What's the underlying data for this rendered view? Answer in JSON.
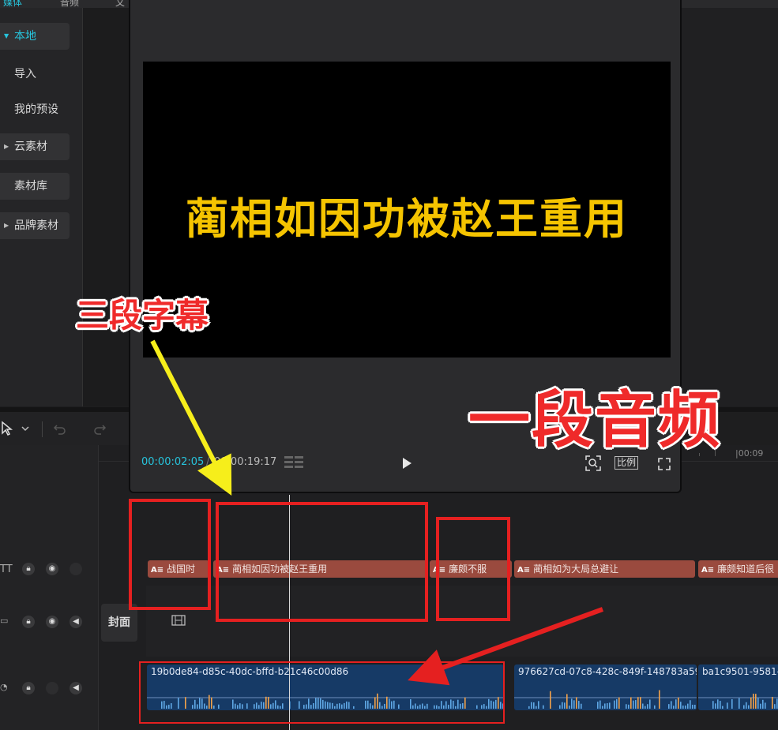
{
  "menu": {
    "items": [
      "媒体",
      "音频",
      "文"
    ]
  },
  "sidebar": {
    "items": [
      {
        "label": "本地",
        "state": "expanded"
      },
      {
        "label": "导入"
      },
      {
        "label": "我的预设"
      },
      {
        "label": "云素材",
        "state": "collapsed"
      },
      {
        "label": "素材库"
      },
      {
        "label": "品牌素材",
        "state": "collapsed"
      }
    ]
  },
  "player": {
    "subtitle": "蔺相如因功被赵王重用",
    "current_time": "00:00:02:05",
    "total_time": "00:00:19:17",
    "ratio_label": "比例"
  },
  "ruler": {
    "label": "|00:09"
  },
  "timeline": {
    "cover_label": "封面",
    "text_clips": [
      "战国时",
      "蔺相如因功被赵王重用",
      "廉颇不服",
      "蔺相如为大局总避让",
      "廉颇知道后很"
    ],
    "audio_clips": [
      "19b0de84-d85c-40dc-bffd-b21c46c00d86",
      "976627cd-07c8-428c-849f-148783a59",
      "ba1c9501-9581-"
    ]
  },
  "annotations": {
    "subtitle_label": "三段字幕",
    "audio_label": "一段音频"
  },
  "colors": {
    "accent": "#27c4dc",
    "subtitle_yellow": "#f5c400",
    "text_clip": "#9a4a3e",
    "audio_clip": "#163a66",
    "annotation_red": "#e52020",
    "annotation_yellow": "#f6ee1b"
  }
}
